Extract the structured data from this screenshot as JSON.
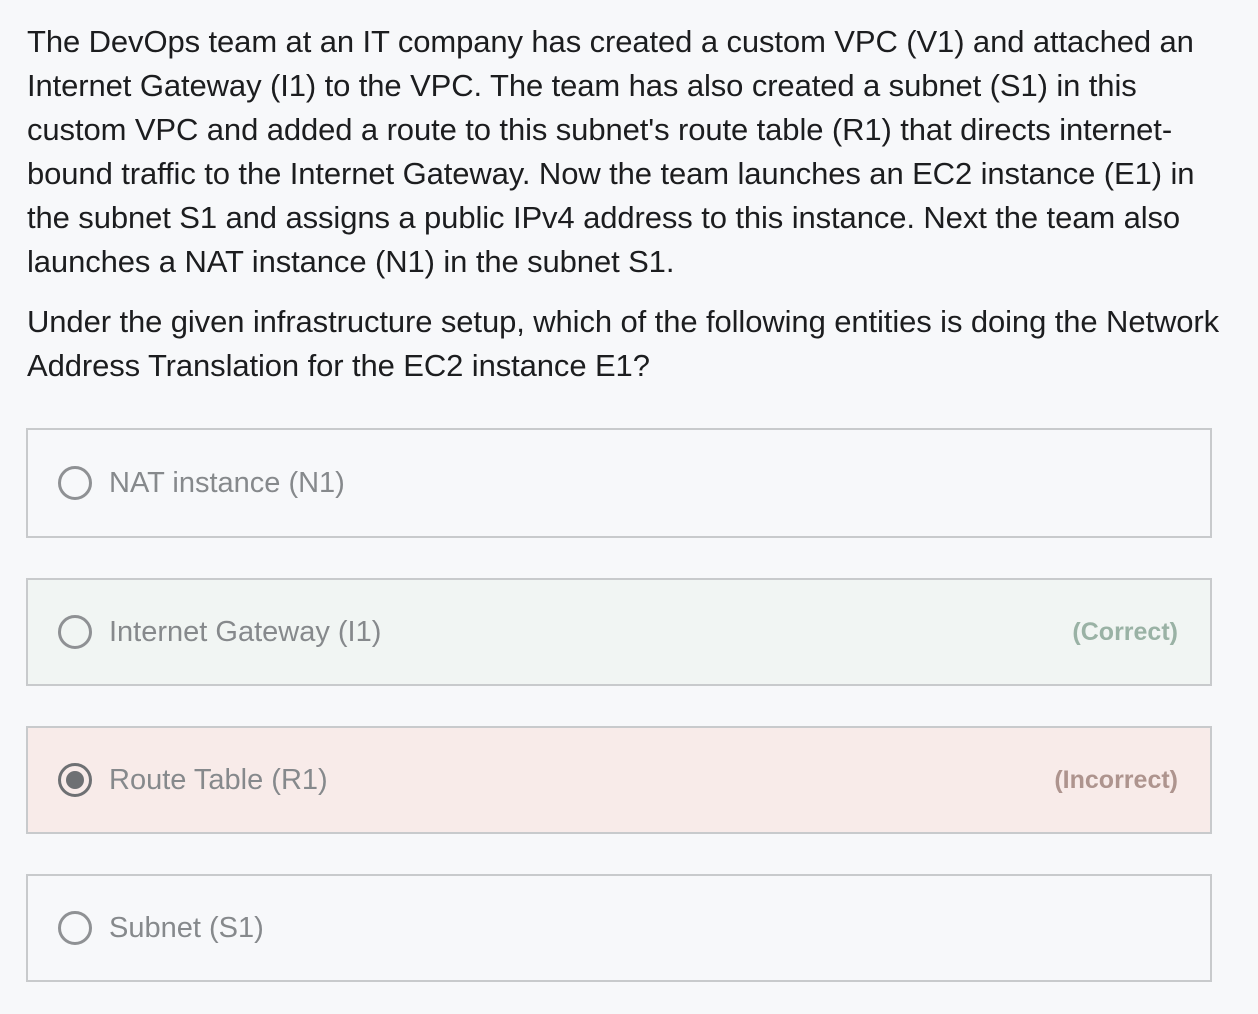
{
  "question": {
    "paragraph1": "The DevOps team at an IT company has created a custom VPC (V1) and attached an Internet Gateway (I1) to the VPC. The team has also created a subnet (S1) in this custom VPC and added a route to this subnet's route table (R1) that directs internet-bound traffic to the Internet Gateway. Now the team launches an EC2 instance (E1) in the subnet S1 and assigns a public IPv4 address to this instance. Next the team also launches a NAT instance (N1) in the subnet S1.",
    "paragraph2": "Under the given infrastructure setup, which of the following entities is doing the Network Address Translation for the EC2 instance E1?"
  },
  "options": [
    {
      "label": "NAT instance (N1)",
      "selected": false,
      "verdict": ""
    },
    {
      "label": "Internet Gateway (I1)",
      "selected": false,
      "verdict": "(Correct)"
    },
    {
      "label": "Route Table (R1)",
      "selected": true,
      "verdict": "(Incorrect)"
    },
    {
      "label": "Subnet (S1)",
      "selected": false,
      "verdict": ""
    }
  ],
  "colors": {
    "correct_background": "#f1f5f3",
    "incorrect_background": "#f8ebe9",
    "correct_text": "#9ab2a5",
    "incorrect_text": "#ae948e"
  }
}
